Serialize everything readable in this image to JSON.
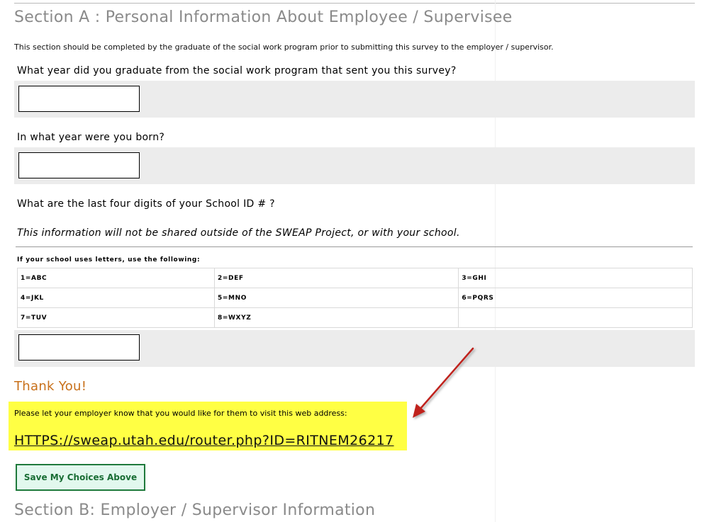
{
  "section_a": {
    "title": "Section A : Personal Information About Employee / Supervisee",
    "intro": "This section should be completed by the graduate of the social work program prior to submitting this survey to the employer / supervisor."
  },
  "questions": {
    "q1": {
      "label": "What year did you graduate from the social work program that sent you this survey?",
      "value": ""
    },
    "q2": {
      "label": "In what year were you born?",
      "value": ""
    },
    "q3": {
      "label": "What are the last four digits of your School ID # ?",
      "note": "This information will not be shared outside of the SWEAP Project, or with your school.",
      "value": ""
    }
  },
  "letters": {
    "title": "If your school uses letters, use the following:",
    "rows": [
      [
        "1=ABC",
        "2=DEF",
        "3=GHI"
      ],
      [
        "4=JKL",
        "5=MNO",
        "6=PQRS"
      ],
      [
        "7=TUV",
        "8=WXYZ",
        ""
      ]
    ]
  },
  "thank_you": {
    "heading": "Thank You!",
    "message": "Please let your employer know that you would like for them to visit this web address:",
    "link": "HTTPS://sweap.utah.edu/router.php?ID=RITNEM26217",
    "highlight_color": "#ffff44"
  },
  "save_button": {
    "label": "Save My Choices Above"
  },
  "section_b": {
    "title": "Section B: Employer / Supervisor Information"
  },
  "annotation": {
    "arrow_color": "#c0201c"
  }
}
